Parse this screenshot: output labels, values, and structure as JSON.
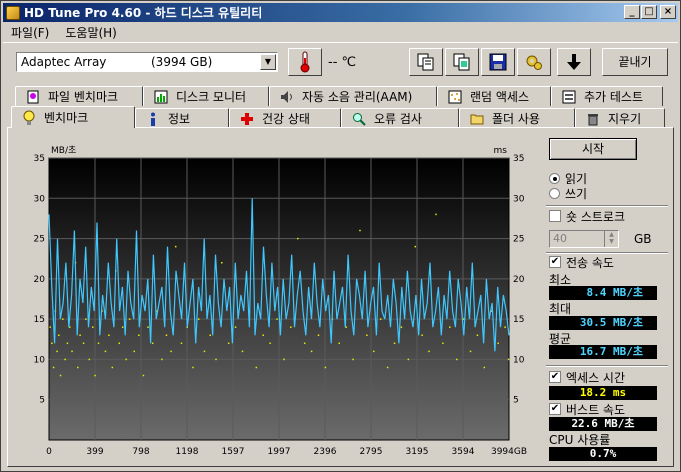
{
  "window": {
    "title": "HD Tune Pro 4.60 - 하드 디스크 유틸리티",
    "controls": [
      "_",
      "□",
      "×"
    ]
  },
  "menu": [
    "파일(F)",
    "도움말(H)"
  ],
  "toolbar": {
    "drive_name": "Adaptec Array",
    "drive_size": "(3994 GB)",
    "temperature": "-- ℃",
    "exit_label": "끝내기",
    "icons": [
      "thermometer-icon",
      "copy-icon",
      "copy-screenshot-icon",
      "save-icon",
      "options-icon",
      "download-icon"
    ]
  },
  "tabs_top": [
    {
      "label": "파일 벤치마크",
      "icon": "file-benchmark-icon"
    },
    {
      "label": "디스크 모니터",
      "icon": "disk-monitor-icon"
    },
    {
      "label": "자동 소음 관리(AAM)",
      "icon": "speaker-icon"
    },
    {
      "label": "랜덤 액세스",
      "icon": "random-access-icon"
    },
    {
      "label": "추가 테스트",
      "icon": "extra-tests-icon"
    }
  ],
  "tabs_bottom": [
    {
      "label": "벤치마크",
      "icon": "benchmark-icon",
      "active": true
    },
    {
      "label": "정보",
      "icon": "info-icon"
    },
    {
      "label": "건강 상태",
      "icon": "health-icon"
    },
    {
      "label": "오류 검사",
      "icon": "error-scan-icon"
    },
    {
      "label": "폴더 사용",
      "icon": "folder-usage-icon"
    },
    {
      "label": "지우기",
      "icon": "erase-icon"
    }
  ],
  "panel": {
    "start_label": "시작",
    "read_label": "읽기",
    "write_label": "쓰기",
    "short_stroke_label": "숏 스트로크",
    "short_stroke_value": "40",
    "short_stroke_unit": "GB",
    "transfer_rate_label": "전송 속도",
    "min_label": "최소",
    "min_value": "8.4 MB/초",
    "max_label": "최대",
    "max_value": "30.5 MB/초",
    "avg_label": "평균",
    "avg_value": "16.7 MB/초",
    "access_time_label": "엑세스 시간",
    "access_time_value": "18.2 ms",
    "burst_rate_label": "버스트 속도",
    "burst_rate_value": "22.6 MB/초",
    "cpu_label": "CPU 사용률",
    "cpu_value": "0.7%",
    "read_selected": true,
    "short_stroke_checked": false,
    "transfer_checked": true,
    "access_checked": true,
    "burst_checked": true
  },
  "chart_data": {
    "type": "line",
    "ylabel_left": "MB/초",
    "ylabel_right": "ms",
    "ylim": [
      0,
      35
    ],
    "yticks": [
      5,
      10,
      15,
      20,
      25,
      30,
      35
    ],
    "xlim": [
      0,
      3994
    ],
    "xticks": [
      "0",
      "399",
      "798",
      "1198",
      "1597",
      "1997",
      "2396",
      "2795",
      "3195",
      "3594",
      "3994GB"
    ],
    "grid": true,
    "series": [
      {
        "color": "#3ec8ff",
        "values": [
          28,
          19,
          12,
          25,
          15,
          17,
          22,
          14,
          18,
          26,
          13,
          20,
          17,
          24,
          14,
          19,
          16,
          27,
          13,
          18,
          15,
          22,
          17,
          14,
          25,
          16,
          19,
          13,
          21,
          17,
          15,
          26,
          14,
          18,
          16,
          20,
          12,
          23,
          15,
          17,
          19,
          14,
          24,
          16,
          13,
          21,
          18,
          15,
          22,
          14,
          17,
          20,
          12,
          19,
          16,
          25,
          15,
          18,
          13,
          23,
          17,
          14,
          20,
          16,
          19,
          12,
          22,
          15,
          18,
          16,
          21,
          14,
          30,
          13,
          17,
          15,
          24,
          18,
          14,
          22,
          16,
          19,
          13,
          20,
          15,
          17,
          23,
          14,
          18,
          21,
          16,
          13,
          19,
          15,
          22,
          17,
          14,
          20,
          16,
          18,
          12,
          21,
          15,
          17,
          19,
          14,
          23,
          16,
          13,
          20,
          18,
          15,
          21,
          14,
          17,
          19,
          13,
          22,
          16,
          15,
          18,
          14,
          20,
          17,
          12,
          19,
          15,
          21,
          16,
          14,
          18,
          13,
          20,
          15,
          17,
          22,
          14,
          16,
          19,
          13,
          18,
          15,
          21,
          16,
          14,
          20,
          17,
          13,
          19,
          15,
          22,
          14,
          16,
          18,
          12,
          20,
          15,
          17,
          11,
          19,
          14,
          18,
          16,
          13
        ]
      }
    ],
    "access_points_ms": [
      [
        10,
        14
      ],
      [
        25,
        12
      ],
      [
        40,
        9
      ],
      [
        55,
        16
      ],
      [
        70,
        11
      ],
      [
        85,
        13
      ],
      [
        100,
        8
      ],
      [
        120,
        15
      ],
      [
        140,
        10
      ],
      [
        160,
        12
      ],
      [
        180,
        14
      ],
      [
        200,
        11
      ],
      [
        230,
        22
      ],
      [
        250,
        9
      ],
      [
        270,
        13
      ],
      [
        300,
        12
      ],
      [
        320,
        15
      ],
      [
        350,
        10
      ],
      [
        380,
        14
      ],
      [
        400,
        8
      ],
      [
        430,
        12
      ],
      [
        460,
        16
      ],
      [
        490,
        11
      ],
      [
        520,
        13
      ],
      [
        550,
        9
      ],
      [
        580,
        21
      ],
      [
        610,
        12
      ],
      [
        640,
        14
      ],
      [
        670,
        10
      ],
      [
        700,
        15
      ],
      [
        740,
        11
      ],
      [
        780,
        13
      ],
      [
        820,
        8
      ],
      [
        860,
        14
      ],
      [
        900,
        12
      ],
      [
        940,
        16
      ],
      [
        980,
        10
      ],
      [
        1020,
        13
      ],
      [
        1060,
        11
      ],
      [
        1100,
        24
      ],
      [
        1150,
        12
      ],
      [
        1200,
        14
      ],
      [
        1250,
        9
      ],
      [
        1300,
        15
      ],
      [
        1350,
        11
      ],
      [
        1400,
        13
      ],
      [
        1450,
        10
      ],
      [
        1500,
        22
      ],
      [
        1560,
        12
      ],
      [
        1620,
        14
      ],
      [
        1680,
        11
      ],
      [
        1740,
        16
      ],
      [
        1800,
        9
      ],
      [
        1860,
        13
      ],
      [
        1920,
        12
      ],
      [
        1980,
        15
      ],
      [
        2040,
        10
      ],
      [
        2100,
        14
      ],
      [
        2160,
        25
      ],
      [
        2220,
        12
      ],
      [
        2280,
        11
      ],
      [
        2340,
        13
      ],
      [
        2400,
        9
      ],
      [
        2460,
        15
      ],
      [
        2520,
        12
      ],
      [
        2580,
        14
      ],
      [
        2640,
        10
      ],
      [
        2700,
        26
      ],
      [
        2760,
        13
      ],
      [
        2820,
        11
      ],
      [
        2880,
        15
      ],
      [
        2940,
        9
      ],
      [
        3000,
        12
      ],
      [
        3060,
        14
      ],
      [
        3120,
        10
      ],
      [
        3180,
        24
      ],
      [
        3240,
        13
      ],
      [
        3300,
        11
      ],
      [
        3360,
        28
      ],
      [
        3420,
        12
      ],
      [
        3480,
        14
      ],
      [
        3540,
        10
      ],
      [
        3600,
        15
      ],
      [
        3660,
        11
      ],
      [
        3720,
        13
      ],
      [
        3780,
        9
      ],
      [
        3840,
        16
      ],
      [
        3900,
        12
      ],
      [
        3960,
        14
      ],
      [
        3990,
        10
      ]
    ]
  }
}
